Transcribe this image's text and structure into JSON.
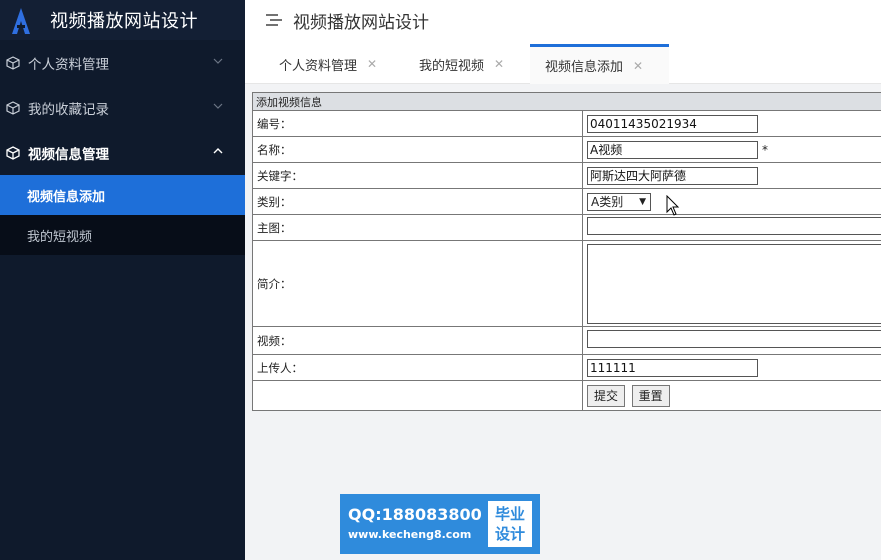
{
  "app": {
    "title": "视频播放网站设计"
  },
  "sidebar": {
    "items": [
      {
        "label": "个人资料管理",
        "icon": "cube-icon",
        "expanded": false
      },
      {
        "label": "我的收藏记录",
        "icon": "cube-icon",
        "expanded": false
      },
      {
        "label": "视频信息管理",
        "icon": "cube-icon",
        "expanded": true
      }
    ],
    "subitems": [
      {
        "label": "视频信息添加",
        "active": true
      },
      {
        "label": "我的短视频",
        "active": false
      }
    ]
  },
  "header": {
    "title": "视频播放网站设计",
    "menu_icon": "menu-icon"
  },
  "tabs": [
    {
      "label": "个人资料管理",
      "active": false
    },
    {
      "label": "我的短视频",
      "active": false
    },
    {
      "label": "视频信息添加",
      "active": true
    }
  ],
  "form": {
    "heading": "添加视频信息",
    "fields": {
      "number": {
        "label": "编号：",
        "value": "04011435021934"
      },
      "name": {
        "label": "名称：",
        "value": "A视频",
        "required_mark": "*"
      },
      "keywords": {
        "label": "关键字：",
        "value": "阿斯达四大阿萨德"
      },
      "category": {
        "label": "类别：",
        "value": "A类别"
      },
      "image": {
        "label": "主图：",
        "value": ""
      },
      "intro": {
        "label": "简介：",
        "value": ""
      },
      "video": {
        "label": "视频：",
        "value": ""
      },
      "uploader": {
        "label": "上传人：",
        "value": "111111"
      }
    },
    "submit_label": "提交",
    "reset_label": "重置"
  },
  "watermark": {
    "qq": "QQ:188083800",
    "url": "www.kecheng8.com",
    "badge_line1": "毕业",
    "badge_line2": "设计"
  },
  "colors": {
    "sidebar_bg": "#0f1a2c",
    "accent": "#1e6fd9",
    "watermark": "#2f8bdc"
  }
}
